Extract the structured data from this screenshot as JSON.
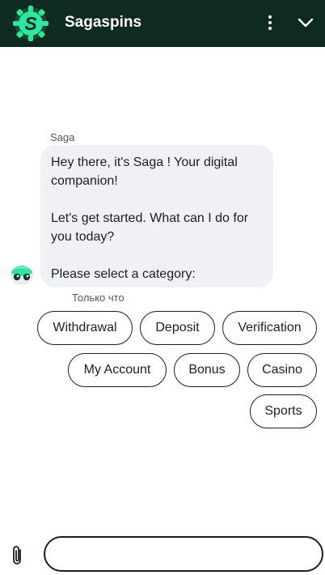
{
  "header": {
    "brand_name": "Sagaspins",
    "logo_letter": "S",
    "menu_icon": "more-vertical-icon",
    "collapse_icon": "chevron-down-icon",
    "background_color": "#0f2a20",
    "accent_color": "#2ee6a0"
  },
  "chat": {
    "sender_name": "Saga",
    "message_lines": [
      "Hey there, it's Saga ! Your digital companion!",
      "Let's get started. What can I do for you today?",
      "Please select a category:"
    ],
    "timestamp": "Только что",
    "avatar_icon": "bot-avatar-icon"
  },
  "categories": [
    "Withdrawal",
    "Deposit",
    "Verification",
    "My Account",
    "Bonus",
    "Casino",
    "Sports"
  ],
  "composer": {
    "attach_icon": "paperclip-icon",
    "input_value": "",
    "input_placeholder": ""
  }
}
